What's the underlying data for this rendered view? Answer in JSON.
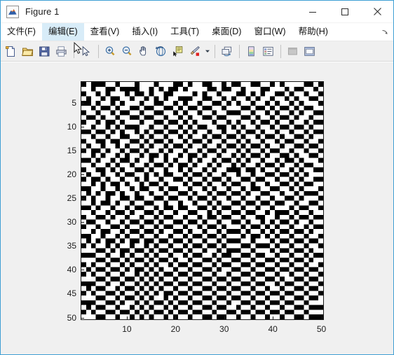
{
  "window": {
    "title": "Figure 1",
    "app_icon": "matlab-membrane-icon",
    "frame_color": "#3f9fd4",
    "background": "#f0f0f0",
    "controls": [
      {
        "name": "minimize-button",
        "glyph": "minimize-icon"
      },
      {
        "name": "maximize-button",
        "glyph": "maximize-icon"
      },
      {
        "name": "close-button",
        "glyph": "close-icon"
      }
    ]
  },
  "menubar": {
    "items": [
      {
        "label": "文件(F)",
        "name": "menu-file",
        "active": false
      },
      {
        "label": "编辑(E)",
        "name": "menu-edit",
        "active": true
      },
      {
        "label": "查看(V)",
        "name": "menu-view",
        "active": false
      },
      {
        "label": "插入(I)",
        "name": "menu-insert",
        "active": false
      },
      {
        "label": "工具(T)",
        "name": "menu-tools",
        "active": false
      },
      {
        "label": "桌面(D)",
        "name": "menu-desktop",
        "active": false
      },
      {
        "label": "窗口(W)",
        "name": "menu-window",
        "active": false
      },
      {
        "label": "帮助(H)",
        "name": "menu-help",
        "active": false
      }
    ],
    "overflow_icon": "menu-overflow-arrow-icon"
  },
  "toolbar": {
    "groups": [
      [
        "new-figure-icon",
        "open-file-icon",
        "save-figure-icon",
        "print-figure-icon"
      ],
      [
        "pointer-arrow-icon"
      ],
      [
        "zoom-in-icon",
        "zoom-out-icon",
        "pan-icon",
        "rotate-3d-icon",
        "data-cursor-icon",
        "brush-icon"
      ],
      [
        "link-plot-icon"
      ],
      [
        "colorbar-icon",
        "legend-icon"
      ],
      [
        "plot-browser-icon",
        "figure-palette-icon"
      ]
    ],
    "brush_has_caret": true
  },
  "chart_data": {
    "type": "heatmap",
    "title": "",
    "xlabel": "",
    "ylabel": "",
    "colormap": "gray-binary",
    "colors": {
      "zero": "#000000",
      "one": "#ffffff"
    },
    "grid": false,
    "legend": "none",
    "rows": 50,
    "cols": 50,
    "xlim": [
      0.5,
      50.5
    ],
    "ylim": [
      0.5,
      50.5
    ],
    "y_axis_direction": "reverse",
    "xticks": [
      10,
      20,
      30,
      40,
      50
    ],
    "yticks": [
      5,
      10,
      15,
      20,
      25,
      30,
      35,
      40,
      45,
      50
    ],
    "xticklabels": [
      "10",
      "20",
      "30",
      "40",
      "50"
    ],
    "yticklabels": [
      "5",
      "10",
      "15",
      "20",
      "25",
      "30",
      "35",
      "40",
      "45",
      "50"
    ],
    "description": "50x50 random binary matrix rendered with imagesc / image; values are 0 (black) or 1 (white), approximately 50% fill.",
    "values": [
      "01000110111011101110010110011010011001101011110010",
      "11011001000011010100101111001001101110011101001101",
      "01101011101001011001111010110111001010110010110110",
      "10110100110110101011000110011010110101101101011001",
      "00101101011101100110101101100101011011010110101110",
      "11010010110010011001010010011011100100101001010011",
      "01101101001101100110101101101100011011010110101100",
      "10010110110010011011010110010011100101101001011011",
      "01101001011101100100101011101101011010010110110100",
      "11011010100011011011010100110010101101101001001011",
      "00100101011010100100101011011011010010110110110100",
      "11011011001101011011010110100100101101001011001011",
      "01100100110010100101101001011011010110110100110110",
      "10110110101101011010010110110100101001011011001001",
      "01001011010010110101101101001011010110100110110110",
      "11010110101101001011010010110110101001011001011001",
      "00101101001011011010110101101001010110110100101110",
      "11011010110110100101001011010110101101001011010011",
      "01100101011001011011010110101100010010110110101100",
      "10110110100110101001101001011011011011001001010111",
      "01001011011010110110010110100101100100110110101100",
      "11010100101101001011101001011010011011011001010011",
      "00110110110100110100110110101101101001100110101110",
      "10101001011011011011001011010010010110011011010001",
      "01011011001001100100110100101101101101101100101110",
      "11010010110110011011011011010110010010010011011001",
      "00101101101001101001001100101001101101101110100110",
      "11011010010110010110110011010110010011010001011011",
      "01100101101101101001101101001001101100110110100100",
      "10011011010010010110010010110110010110101001011011",
      "01101100101101101001101101001011101001010110110100",
      "11010011010010010110010110110100010110101001001011",
      "00110110101101101101101001001011101001010110110110",
      "10101001010010010010010110110100011011101001001001",
      "01011010110110101101101001001011100100010110110110",
      "11100101001001010010010110110100011011101001001011",
      "00011011010110101101101001101001100100110110110100",
      "11100100101001010010110110010110011011001001001011",
      "01011011010110101101001001101001100100110110110110",
      "10100100101001010110110110010110011011001001001001",
      "01011011011010101001001001101101100100110110110110",
      "11100100100101010110110110010010011011001011001001",
      "00011011011010101001001001101101100100110100110110",
      "10100110100101010110110110010010011011011011001001",
      "01011001011010101001001001101101100100100100110110",
      "11100110100101011010110110010010011011011011001001",
      "00011001011010100101001001101101100100100100110111",
      "10100110110101011010110110010011011011011011001000",
      "01011001001010100101001001101100100100100100110111",
      "11100110110101011010110110010011011011011011001000"
    ]
  }
}
